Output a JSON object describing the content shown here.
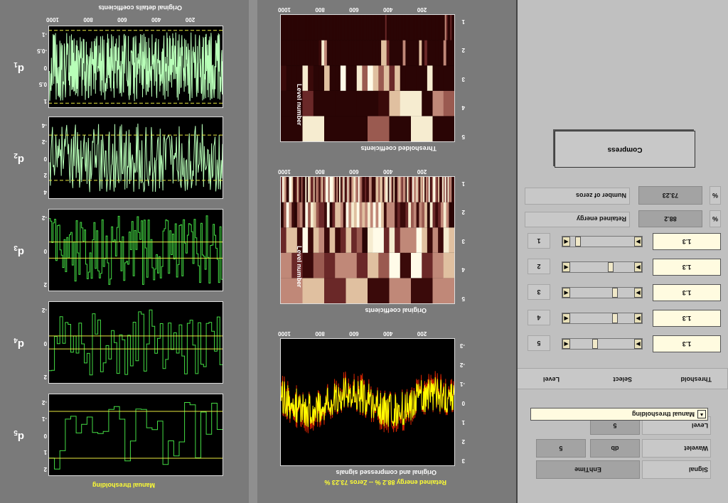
{
  "left_panel": {
    "top_title": "Original details coefficients",
    "x_ticks": [
      "200",
      "400",
      "600",
      "800",
      "1000"
    ],
    "footer": "Manual thresholding",
    "axes": [
      {
        "label": "d",
        "sub": "1",
        "y_ticks": [
          "-1",
          "-0.5",
          "0",
          "0.5",
          "1"
        ],
        "threshold": 0.95
      },
      {
        "label": "d",
        "sub": "2",
        "y_ticks": [
          "-4",
          "-2",
          "0",
          "2",
          "4"
        ],
        "threshold": 1.3
      },
      {
        "label": "d",
        "sub": "3",
        "y_ticks": [
          "-2",
          "0",
          "2"
        ],
        "threshold": 0.5
      },
      {
        "label": "d",
        "sub": "4",
        "y_ticks": [
          "-2",
          "0",
          "2"
        ],
        "threshold": 0.5
      },
      {
        "label": "d",
        "sub": "5",
        "y_ticks": [
          "-2",
          "-1",
          "0",
          "1",
          "2"
        ],
        "threshold": 1.3
      }
    ]
  },
  "middle_panel": {
    "x_ticks": [
      "200",
      "400",
      "600",
      "800",
      "1000"
    ],
    "thresholded": {
      "title": "Thresholded coefficients",
      "ylabel": "Level number",
      "y_ticks": [
        "1",
        "2",
        "3",
        "4",
        "5"
      ]
    },
    "original": {
      "title": "Original coefficients",
      "ylabel": "Level number",
      "y_ticks": [
        "1",
        "2",
        "3",
        "4",
        "5"
      ]
    },
    "signals": {
      "title": "Original and compressed signals",
      "y_ticks": [
        "-3",
        "-2",
        "-1",
        "0",
        "1",
        "2",
        "3"
      ]
    },
    "footer": "Retained energy 88.2 % -- Zeros 73.23 %"
  },
  "right_panel": {
    "signal_label": "Signal",
    "signal_value": "EnhTime",
    "wavelet_label": "Wavelet",
    "wavelet_family": "db",
    "wavelet_order": "5",
    "level_label": "Level",
    "level_value": "5",
    "method": "Manual thresholding",
    "col_level": "Level",
    "col_select": "Select",
    "col_threshold": "Threshold",
    "rows": [
      {
        "level": "5",
        "value": "1.3",
        "pos": 0.62
      },
      {
        "level": "4",
        "value": "1.3",
        "pos": 0.28
      },
      {
        "level": "3",
        "value": "1.3",
        "pos": 0.28
      },
      {
        "level": "2",
        "value": "1.3",
        "pos": 0.35
      },
      {
        "level": "1",
        "value": "1.3",
        "pos": 0.92
      }
    ],
    "retained_energy_label": "Retained energy",
    "retained_energy_value": "88.2",
    "retained_energy_unit": "%",
    "zeros_label": "Number of zeros",
    "zeros_value": "73.23",
    "zeros_unit": "%",
    "compress_label": "Compress"
  },
  "colors": {
    "signal_green": "#aaffaa",
    "thresh_yellow": "#e8e840",
    "original": "#ffff00",
    "compressed": "#cc2200"
  }
}
